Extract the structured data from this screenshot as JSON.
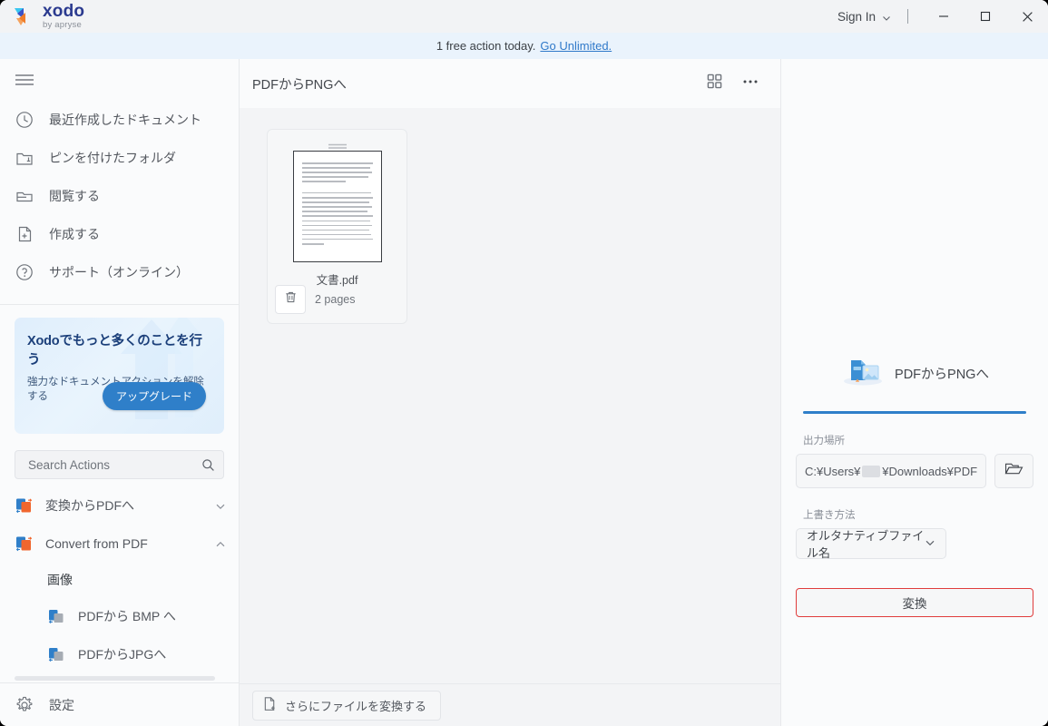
{
  "window": {
    "title": "xodo",
    "logo_name": "xodo",
    "logo_sub": "by apryse",
    "sign_in_label": "Sign In",
    "minimize_label": "Minimize",
    "maximize_label": "Maximize",
    "close_label": "Close"
  },
  "promo_strip": {
    "text": "1 free action today.",
    "link_label": "Go Unlimited."
  },
  "sidebar": {
    "menu_icon": "hamburger-icon",
    "nav_items": [
      {
        "label": "最近作成したドキュメント",
        "icon": "clock-icon"
      },
      {
        "label": "ピンを付けたフォルダ",
        "icon": "pinned-folder-icon"
      },
      {
        "label": "閲覧する",
        "icon": "folder-icon"
      },
      {
        "label": "作成する",
        "icon": "file-plus-icon"
      },
      {
        "label": "サポート（オンライン）",
        "icon": "question-circle-icon"
      }
    ],
    "promo_card": {
      "title": "Xodoでもっと多くのことを行う",
      "subtitle": "強力なドキュメントアクションを解除する",
      "button_label": "アップグレード"
    },
    "search": {
      "placeholder": "Search Actions",
      "value": "",
      "icon": "search-icon"
    },
    "actions": [
      {
        "label": "変換からPDFへ",
        "icon": "convert-pdf-icon",
        "chevron": "chevron-down-icon",
        "expanded": false
      },
      {
        "label": "Convert from PDF",
        "icon": "convert-pdf-icon",
        "chevron": "chevron-up-icon",
        "expanded": true
      }
    ],
    "action_group": {
      "heading": "画像",
      "items": [
        {
          "label": "PDFから BMP へ",
          "icon": "pdf-to-image-icon"
        },
        {
          "label": "PDFからJPGへ",
          "icon": "pdf-to-image-icon"
        }
      ]
    },
    "footer": {
      "label": "設定",
      "icon": "gear-icon"
    }
  },
  "main": {
    "title": "PDFからPNGへ",
    "grid_view_icon": "grid-view-icon",
    "overflow_icon": "more-options-icon",
    "file_card": {
      "grip_icon": "drag-handle-icon",
      "filename": "文書.pdf",
      "pages": "2 pages",
      "delete_icon": "trash-icon"
    },
    "footer_button": {
      "label": "さらにファイルを変換する",
      "icon": "add-file-icon"
    }
  },
  "right_panel": {
    "title": "PDFからPNGへ",
    "title_icon": "pdf-to-png-illustration",
    "accent_color": "#2f7fc9",
    "output_location": {
      "label": "出力場所",
      "value_prefix": "C:¥Users¥",
      "value_redacted": true,
      "value_suffix": "¥Downloads¥PDF",
      "browse_icon": "open-folder-icon"
    },
    "overwrite_method": {
      "label": "上書き方法",
      "value": "オルタナティブファイル名",
      "chevron": "chevron-down-icon"
    },
    "convert_button": {
      "label": "変換",
      "highlight_color": "#e03c3c"
    }
  }
}
